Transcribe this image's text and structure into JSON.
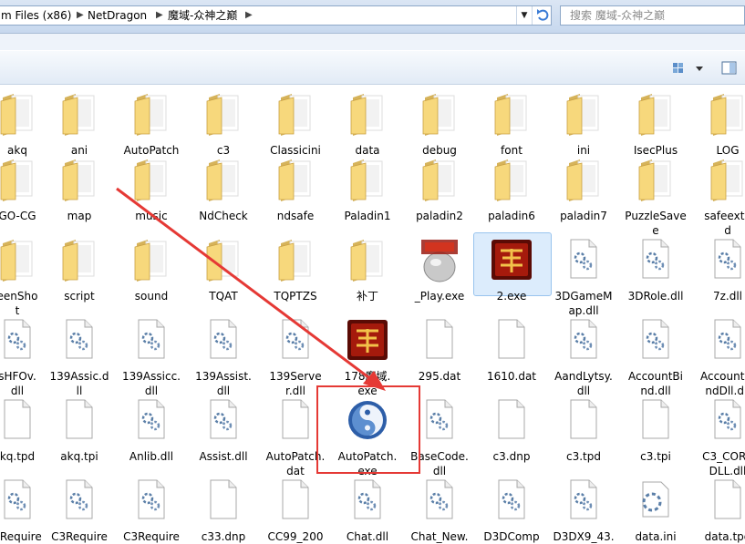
{
  "address": {
    "segments": [
      "m Files (x86)",
      "NetDragon",
      "魔域-众神之巅"
    ],
    "search_placeholder": "搜索 魔域-众神之巅"
  },
  "toolbar": {
    "view_icon": "view-options-icon",
    "pane_icon": "preview-pane-icon"
  },
  "files": [
    {
      "label": "akq",
      "type": "folder"
    },
    {
      "label": "ani",
      "type": "folder"
    },
    {
      "label": "AutoPatch",
      "type": "folder"
    },
    {
      "label": "c3",
      "type": "folder"
    },
    {
      "label": "Classicini",
      "type": "folder"
    },
    {
      "label": "data",
      "type": "folder"
    },
    {
      "label": "debug",
      "type": "folder"
    },
    {
      "label": "font",
      "type": "folder"
    },
    {
      "label": "ini",
      "type": "folder"
    },
    {
      "label": "IsecPlus",
      "type": "folder"
    },
    {
      "label": "LOG",
      "type": "folder"
    },
    {
      "label": "GO-CG",
      "type": "folder"
    },
    {
      "label": "map",
      "type": "folder"
    },
    {
      "label": "music",
      "type": "folder"
    },
    {
      "label": "NdCheck",
      "type": "folder"
    },
    {
      "label": "ndsafe",
      "type": "folder"
    },
    {
      "label": "Paladin1",
      "type": "folder"
    },
    {
      "label": "paladin2",
      "type": "folder"
    },
    {
      "label": "paladin6",
      "type": "folder"
    },
    {
      "label": "paladin7",
      "type": "folder"
    },
    {
      "label": "PuzzleSave\ne",
      "type": "folder"
    },
    {
      "label": "safeexte\nd",
      "type": "folder"
    },
    {
      "label": "eenSho\nt",
      "type": "folder"
    },
    {
      "label": "script",
      "type": "folder"
    },
    {
      "label": "sound",
      "type": "folder"
    },
    {
      "label": "TQAT",
      "type": "folder"
    },
    {
      "label": "TQPTZS",
      "type": "folder"
    },
    {
      "label": "补丁",
      "type": "folder"
    },
    {
      "label": "_Play.exe",
      "type": "exe-orb"
    },
    {
      "label": "2.exe",
      "type": "exe-game"
    },
    {
      "label": "3DGameM\nap.dll",
      "type": "dll"
    },
    {
      "label": "3DRole.dll",
      "type": "dll"
    },
    {
      "label": "7z.dll",
      "type": "dll"
    },
    {
      "label": "sHFOv.\ndll",
      "type": "dll"
    },
    {
      "label": "139Assic.d\nll",
      "type": "dll"
    },
    {
      "label": "139Assicc.\ndll",
      "type": "dll"
    },
    {
      "label": "139Assist.\ndll",
      "type": "dll"
    },
    {
      "label": "139Serve\nr.dll",
      "type": "dll"
    },
    {
      "label": "178魔域.\nexe",
      "type": "exe-game"
    },
    {
      "label": "295.dat",
      "type": "file"
    },
    {
      "label": "1610.dat",
      "type": "file"
    },
    {
      "label": "AandLytsy.\ndll",
      "type": "dll"
    },
    {
      "label": "AccountBi\nnd.dll",
      "type": "dll"
    },
    {
      "label": "AccountBi\nndDll.dll",
      "type": "dll"
    },
    {
      "label": "kq.tpd",
      "type": "file"
    },
    {
      "label": "akq.tpi",
      "type": "file"
    },
    {
      "label": "Anlib.dll",
      "type": "dll"
    },
    {
      "label": "Assist.dll",
      "type": "dll"
    },
    {
      "label": "AutoPatch.\ndat",
      "type": "file"
    },
    {
      "label": "AutoPatch.\nexe",
      "type": "exe-autopatch"
    },
    {
      "label": "BaseCode.\ndll",
      "type": "dll"
    },
    {
      "label": "c3.dnp",
      "type": "file"
    },
    {
      "label": "c3.tpd",
      "type": "file"
    },
    {
      "label": "c3.tpi",
      "type": "file"
    },
    {
      "label": "C3_CORE\nDLL.dll",
      "type": "dll"
    },
    {
      "label": "3Require",
      "type": "dll"
    },
    {
      "label": "C3Require",
      "type": "dll"
    },
    {
      "label": "C3Require",
      "type": "dll"
    },
    {
      "label": "c33.dnp",
      "type": "file"
    },
    {
      "label": "CC99_200",
      "type": "file"
    },
    {
      "label": "Chat.dll",
      "type": "dll"
    },
    {
      "label": "Chat_New.",
      "type": "dll"
    },
    {
      "label": "D3DComp",
      "type": "dll"
    },
    {
      "label": "D3DX9_43.",
      "type": "dll"
    },
    {
      "label": "data.ini",
      "type": "ini"
    },
    {
      "label": "data.tpd",
      "type": "file"
    }
  ],
  "selected_index": 29,
  "highlighted_index": 49,
  "colors": {
    "highlight": "#e53935",
    "selection": "#dcecfc"
  }
}
